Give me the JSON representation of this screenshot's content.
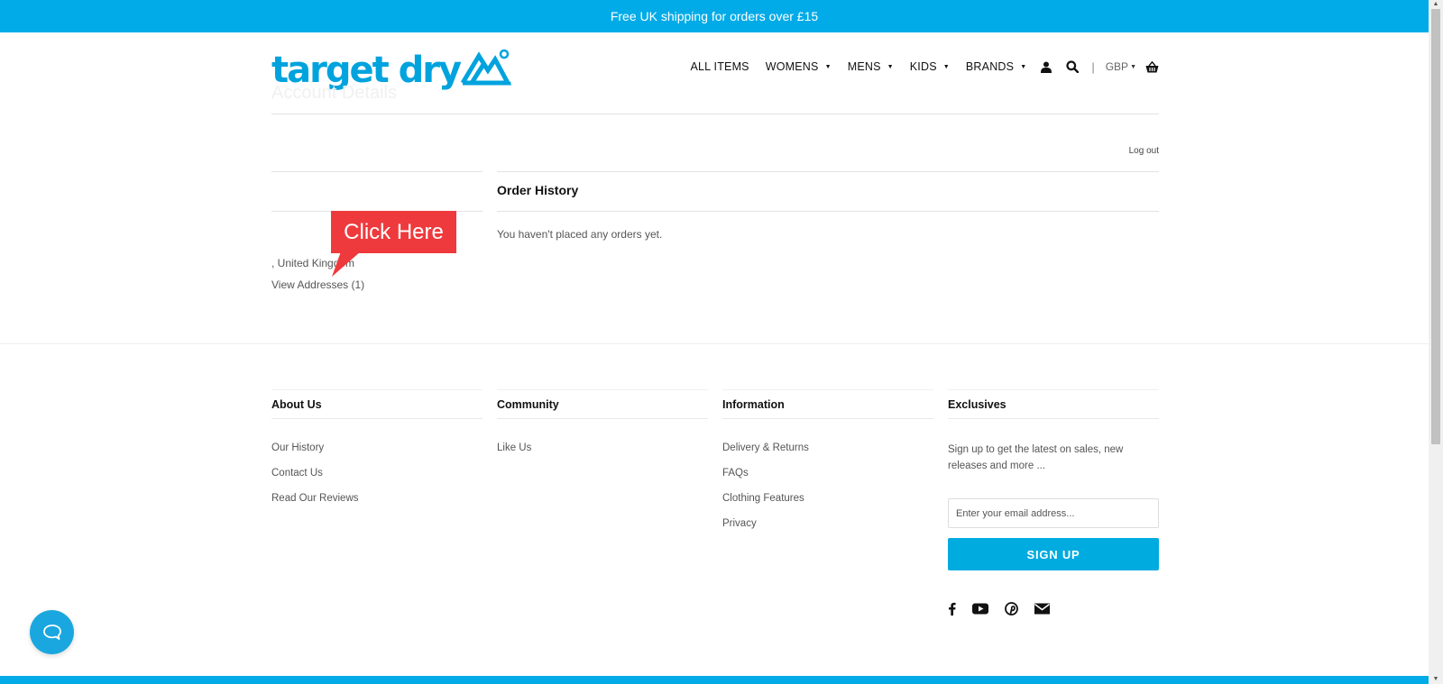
{
  "announcement": "Free UK shipping for orders over £15",
  "brand": {
    "name": "target dry",
    "color": "#00a3dd"
  },
  "nav": {
    "items": [
      {
        "label": "ALL ITEMS",
        "dropdown": false
      },
      {
        "label": "WOMENS",
        "dropdown": true
      },
      {
        "label": "MENS",
        "dropdown": true
      },
      {
        "label": "KIDS",
        "dropdown": true
      },
      {
        "label": "BRANDS",
        "dropdown": true
      }
    ],
    "icons": [
      "user-icon",
      "search-icon",
      "basket-icon"
    ],
    "currency": "GBP",
    "caret": "▼"
  },
  "account": {
    "title": "Account Details",
    "logout": "Log out",
    "order_history_title": "Order History",
    "no_orders": "You haven't placed any orders yet.",
    "address_line": ", United Kingdom",
    "view_addresses": "View Addresses (1)"
  },
  "callout": {
    "label": "Click Here",
    "color": "#ee3a3d"
  },
  "footer": {
    "columns": [
      {
        "title": "About Us",
        "links": [
          "Our History",
          "Contact Us",
          "Read Our Reviews"
        ]
      },
      {
        "title": "Community",
        "links": [
          "Like Us"
        ]
      },
      {
        "title": "Information",
        "links": [
          "Delivery & Returns",
          "FAQs",
          "Clothing Features",
          "Privacy"
        ]
      }
    ],
    "exclusives": {
      "title": "Exclusives",
      "description": "Sign up to get the latest on sales, new releases and more ...",
      "email_placeholder": "Enter your email address...",
      "signup_label": "SIGN UP"
    },
    "social": [
      "facebook-icon",
      "youtube-icon",
      "pinterest-icon",
      "email-icon"
    ]
  },
  "colors": {
    "accent": "#00abe8"
  }
}
